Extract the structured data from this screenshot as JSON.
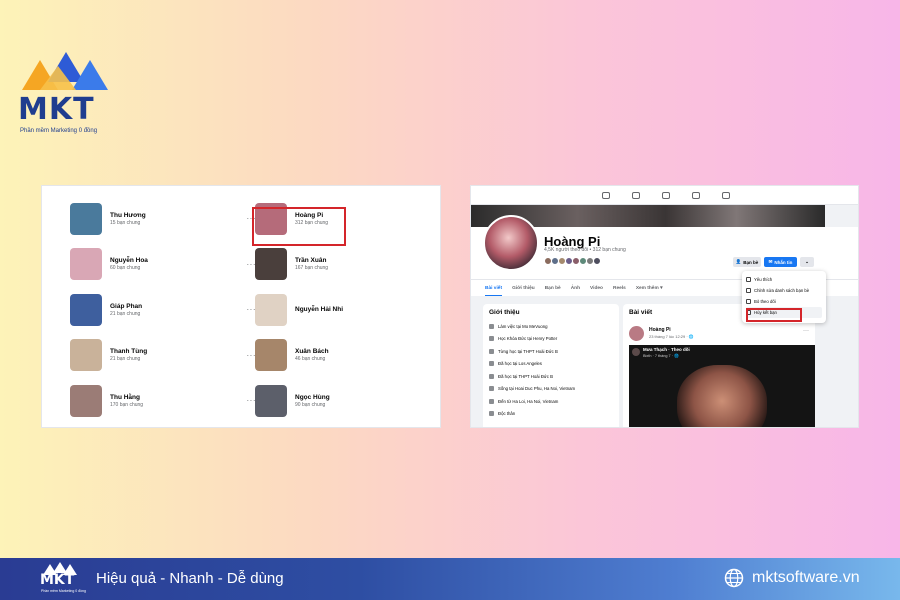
{
  "brand": {
    "name": "MKT",
    "tagline": "Phần mềm Marketing 0 đồng"
  },
  "friends_list": {
    "column1": [
      {
        "name": "Thu Hương",
        "mutual": "15 bạn chung",
        "color": "#4a7a9c"
      },
      {
        "name": "Nguyễn Hoa",
        "mutual": "60 bạn chung",
        "color": "#d9a7b5"
      },
      {
        "name": "Giáp Phan",
        "mutual": "21 bạn chung",
        "color": "#3e5f9e"
      },
      {
        "name": "Thanh Tùng",
        "mutual": "21 bạn chung",
        "color": "#c9b29a"
      },
      {
        "name": "Thu Hằng",
        "mutual": "170 bạn chung",
        "color": "#9b7c76"
      }
    ],
    "column2": [
      {
        "name": "Hoàng Pi",
        "mutual": "312 bạn chung",
        "color": "#b56b7a"
      },
      {
        "name": "Trần Xuân",
        "mutual": "167 bạn chung",
        "color": "#4a3f3c"
      },
      {
        "name": "Nguyễn Hải Nhi",
        "mutual": "",
        "color": "#e0d2c4"
      },
      {
        "name": "Xuân Bách",
        "mutual": "46 bạn chung",
        "color": "#a6866a"
      },
      {
        "name": "Ngọc Hùng",
        "mutual": "90 bạn chung",
        "color": "#5c5f6a"
      }
    ],
    "more_label": "···"
  },
  "profile": {
    "name": "Hoàng Pi",
    "stats": "4,5K người theo dõi • 312 bạn chung",
    "buttons": {
      "friends": "Bạn bè",
      "message": "Nhắn tin",
      "more": "⌄"
    },
    "tabs": [
      "Bài viết",
      "Giới thiệu",
      "Bạn bè",
      "Ảnh",
      "Video",
      "Reels",
      "Xem thêm ▾"
    ],
    "dropdown": [
      "Yêu thích",
      "Chỉnh sửa danh sách bạn bè",
      "Bỏ theo dõi",
      "Hủy kết bạn"
    ],
    "intro_title": "Giới thiệu",
    "intro_items": [
      "Làm việc tại Mo MeVuong",
      "Học Khóa Đức tại Henry Potter",
      "Từng học tại THPT Hoài Đức B",
      "Đã học tại Los Angeles",
      "Đã học tại THPT Hoài Đức B",
      "Sống tại Hoai Duc Phu, Ha Noi, Vietnam",
      "Đến từ Ha Loi, Ha Noi, Vietnam",
      "Độc thân"
    ],
    "posts_title": "Bài viết",
    "post": {
      "author": "Hoàng Pi",
      "time": "23 tháng 7 lúc 12:29 · 🌐",
      "video_title": "Mưa Thạch · Theo dõi",
      "video_sub": "Bixth · 7 tháng 7 · 🌐"
    }
  },
  "footer": {
    "slogan": "Hiệu quả - Nhanh - Dễ dùng",
    "website": "mktsoftware.vn"
  },
  "colors": {
    "accent": "#1877f2",
    "highlight": "#d4252a",
    "brand_blue": "#1f3d8f"
  }
}
